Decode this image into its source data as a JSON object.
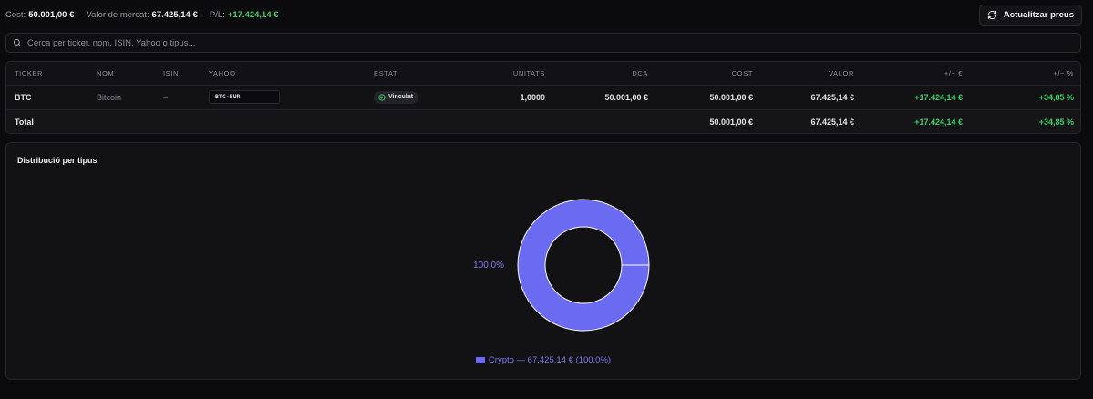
{
  "summary": {
    "cost_label": "Cost:",
    "cost_value": "50.001,00 €",
    "sep": "·",
    "market_label": "Valor de mercat:",
    "market_value": "67.425,14 €",
    "pl_label": "P/L:",
    "pl_value": "+17.424,14 €"
  },
  "toolbar": {
    "refresh_label": "Actualitzar preus",
    "refresh_icon": "refresh-icon"
  },
  "search": {
    "placeholder": "Cerca per ticker, nom, ISIN, Yahoo o tipus...",
    "value": ""
  },
  "table": {
    "headers": [
      "TICKER",
      "NOM",
      "ISIN",
      "YAHOO",
      "ESTAT",
      "UNITATS",
      "DCA",
      "COST",
      "VALOR",
      "+/− €",
      "+/− %"
    ],
    "rows": [
      {
        "ticker": "BTC",
        "name": "Bitcoin",
        "isin": "–",
        "yahoo": "BTC-EUR",
        "status": "Vinculat",
        "units": "1,0000",
        "dca": "50.001,00 €",
        "cost": "50.001,00 €",
        "value": "67.425,14 €",
        "pl_eur": "+17.424,14 €",
        "pl_pct": "+34,85 %"
      }
    ],
    "total": {
      "label": "Total",
      "cost": "50.001,00 €",
      "value": "67.425,14 €",
      "pl_eur": "+17.424,14 €",
      "pl_pct": "+34,85 %"
    }
  },
  "chart_data": {
    "type": "pie",
    "title": "Distribució per tipus",
    "categories": [
      "Crypto"
    ],
    "values": [
      100.0
    ],
    "slice_labels": [
      "100.0%"
    ],
    "legend": [
      "Crypto — 67.425,14 € (100.0%)"
    ],
    "colors": [
      "#6b6bf2"
    ],
    "legend_position": "bottom"
  }
}
